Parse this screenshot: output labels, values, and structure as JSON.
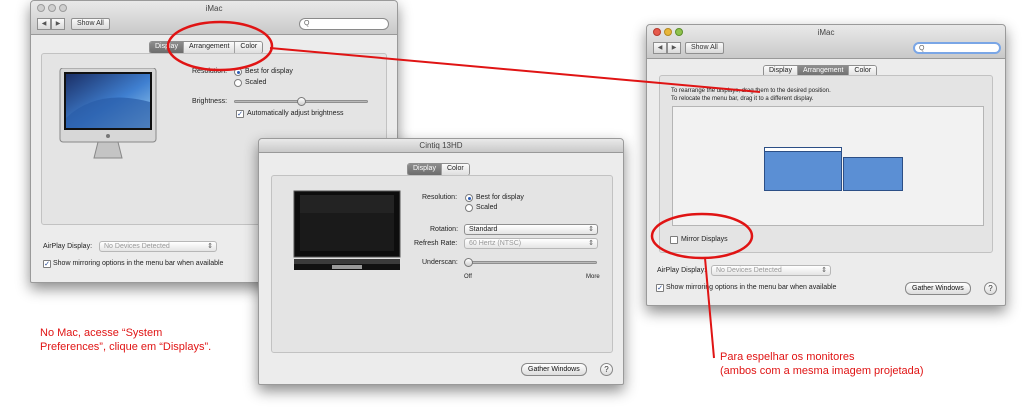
{
  "window_left": {
    "title": "iMac",
    "show_all": "Show All",
    "search_placeholder": "Q",
    "tabs": [
      "Display",
      "Arrangement",
      "Color"
    ],
    "resolution_label": "Resolution:",
    "resolution_options": [
      "Best for display",
      "Scaled"
    ],
    "brightness_label": "Brightness:",
    "auto_brightness": "Automatically adjust brightness",
    "brightness_level": 0.5,
    "airplay_label": "AirPlay Display:",
    "airplay_value": "No Devices Detected",
    "mirroring_option": "Show mirroring options in the menu bar when available"
  },
  "window_cintiq": {
    "title": "Cintiq 13HD",
    "tabs": [
      "Display",
      "Color"
    ],
    "resolution_label": "Resolution:",
    "resolution_options": [
      "Best for display",
      "Scaled"
    ],
    "rotation_label": "Rotation:",
    "rotation_value": "Standard",
    "refresh_label": "Refresh Rate:",
    "refresh_value": "60 Hertz (NTSC)",
    "underscan_label": "Underscan:",
    "underscan_off": "Off",
    "underscan_more": "More",
    "gather_windows": "Gather Windows",
    "help": "?"
  },
  "window_right": {
    "title": "iMac",
    "show_all": "Show All",
    "search_placeholder": "Q",
    "tabs": [
      "Display",
      "Arrangement",
      "Color"
    ],
    "instructions_1": "To rearrange the displays, drag them to the desired position.",
    "instructions_2": "To relocate the menu bar, drag it to a different display.",
    "mirror_displays": "Mirror Displays",
    "airplay_label": "AirPlay Display:",
    "airplay_value": "No Devices Detected",
    "mirroring_option": "Show mirroring options in the menu bar when available",
    "gather_windows": "Gather Windows",
    "help": "?"
  },
  "annotations": {
    "left_note_1": "No Mac, acesse “System",
    "left_note_2": "Preferences”, clique em “Displays”.",
    "right_note_1": "Para espelhar os monitores",
    "right_note_2": "(ambos com a mesma imagem projetada)"
  },
  "colors": {
    "annotation": "#e01414",
    "display_blue": "#5b8fd4",
    "accent": "#2a5bb5"
  }
}
